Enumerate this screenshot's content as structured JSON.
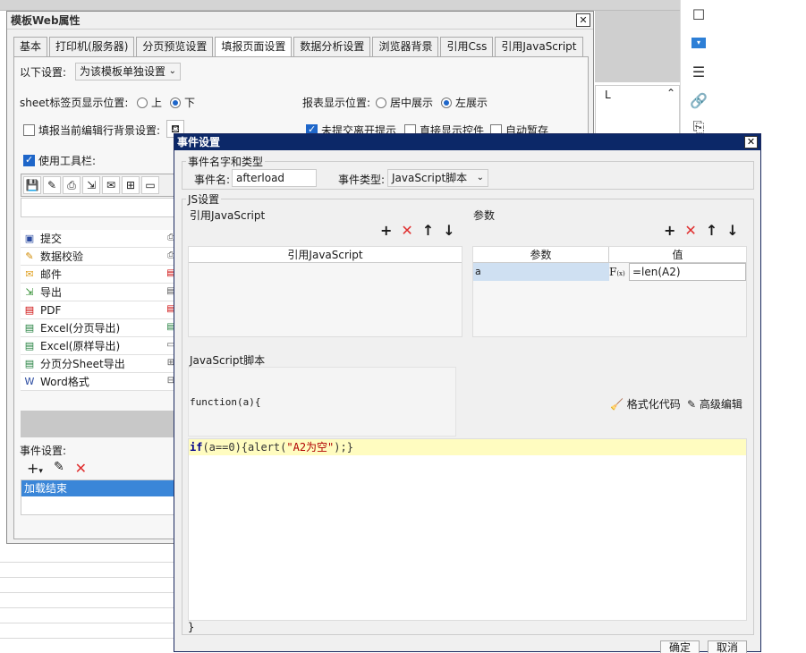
{
  "bg": {
    "col_l": "L",
    "col_up": "⌃"
  },
  "right_panel": {
    "icons": [
      "square-icon",
      "dropdown-icon",
      "stack-icon",
      "link-icon",
      "doc-icon"
    ]
  },
  "dlg1": {
    "title": "模板Web属性",
    "close": "✕",
    "tabs": [
      "基本",
      "打印机(服务器)",
      "分页预览设置",
      "填报页面设置",
      "数据分析设置",
      "浏览器背景",
      "引用Css",
      "引用JavaScript"
    ],
    "active_tab": "填报页面设置",
    "scope_label": "以下设置:",
    "scope_value": "为该模板单独设置",
    "sheet_pos_label": "sheet标签页显示位置:",
    "sheet_pos_opt1": "上",
    "sheet_pos_opt2": "下",
    "report_pos_label": "报表显示位置:",
    "report_pos_opt1": "居中展示",
    "report_pos_opt2": "左展示",
    "fill_bg_label": "填报当前编辑行背景设置:",
    "chk_unsubmitted": "未提交离开提示",
    "chk_direct_show": "直接显示控件",
    "chk_autosave": "自动暂存",
    "use_toolbar": "使用工具栏:",
    "toolbar_items": [
      {
        "label": "提交",
        "icon": "submit-icon"
      },
      {
        "label": "数据校验",
        "icon": "validate-icon"
      },
      {
        "label": "邮件",
        "icon": "mail-icon"
      },
      {
        "label": "导出",
        "icon": "export-icon"
      },
      {
        "label": "PDF",
        "icon": "pdf-icon"
      },
      {
        "label": "Excel(分页导出)",
        "icon": "excel-icon"
      },
      {
        "label": "Excel(原样导出)",
        "icon": "excel-icon"
      },
      {
        "label": "分页分Sheet导出",
        "icon": "excel-icon"
      },
      {
        "label": "Word格式",
        "icon": "word-icon"
      }
    ],
    "event_label": "事件设置:",
    "event_item": "加载结束"
  },
  "dlg2": {
    "title": "事件设置",
    "close": "✕",
    "group1_legend": "事件名字和类型",
    "event_name_label": "事件名:",
    "event_name_value": "afterload",
    "event_type_label": "事件类型:",
    "event_type_value": "JavaScript脚本",
    "js_legend": "JS设置",
    "ref_js_label": "引用JavaScript",
    "ref_js_header": "引用JavaScript",
    "params_label": "参数",
    "param_col_name": "参数",
    "param_col_value": "值",
    "param_name": "a",
    "param_value": "=len(A2)",
    "script_label": "JavaScript脚本",
    "func_sig": "function(a){",
    "format_code": "格式化代码",
    "adv_edit": "高级编辑",
    "code_line": "if(a==0){alert(\"A2为空\");}",
    "close_brace": "}",
    "ok_btn": "确定",
    "cancel_btn": "取消"
  }
}
